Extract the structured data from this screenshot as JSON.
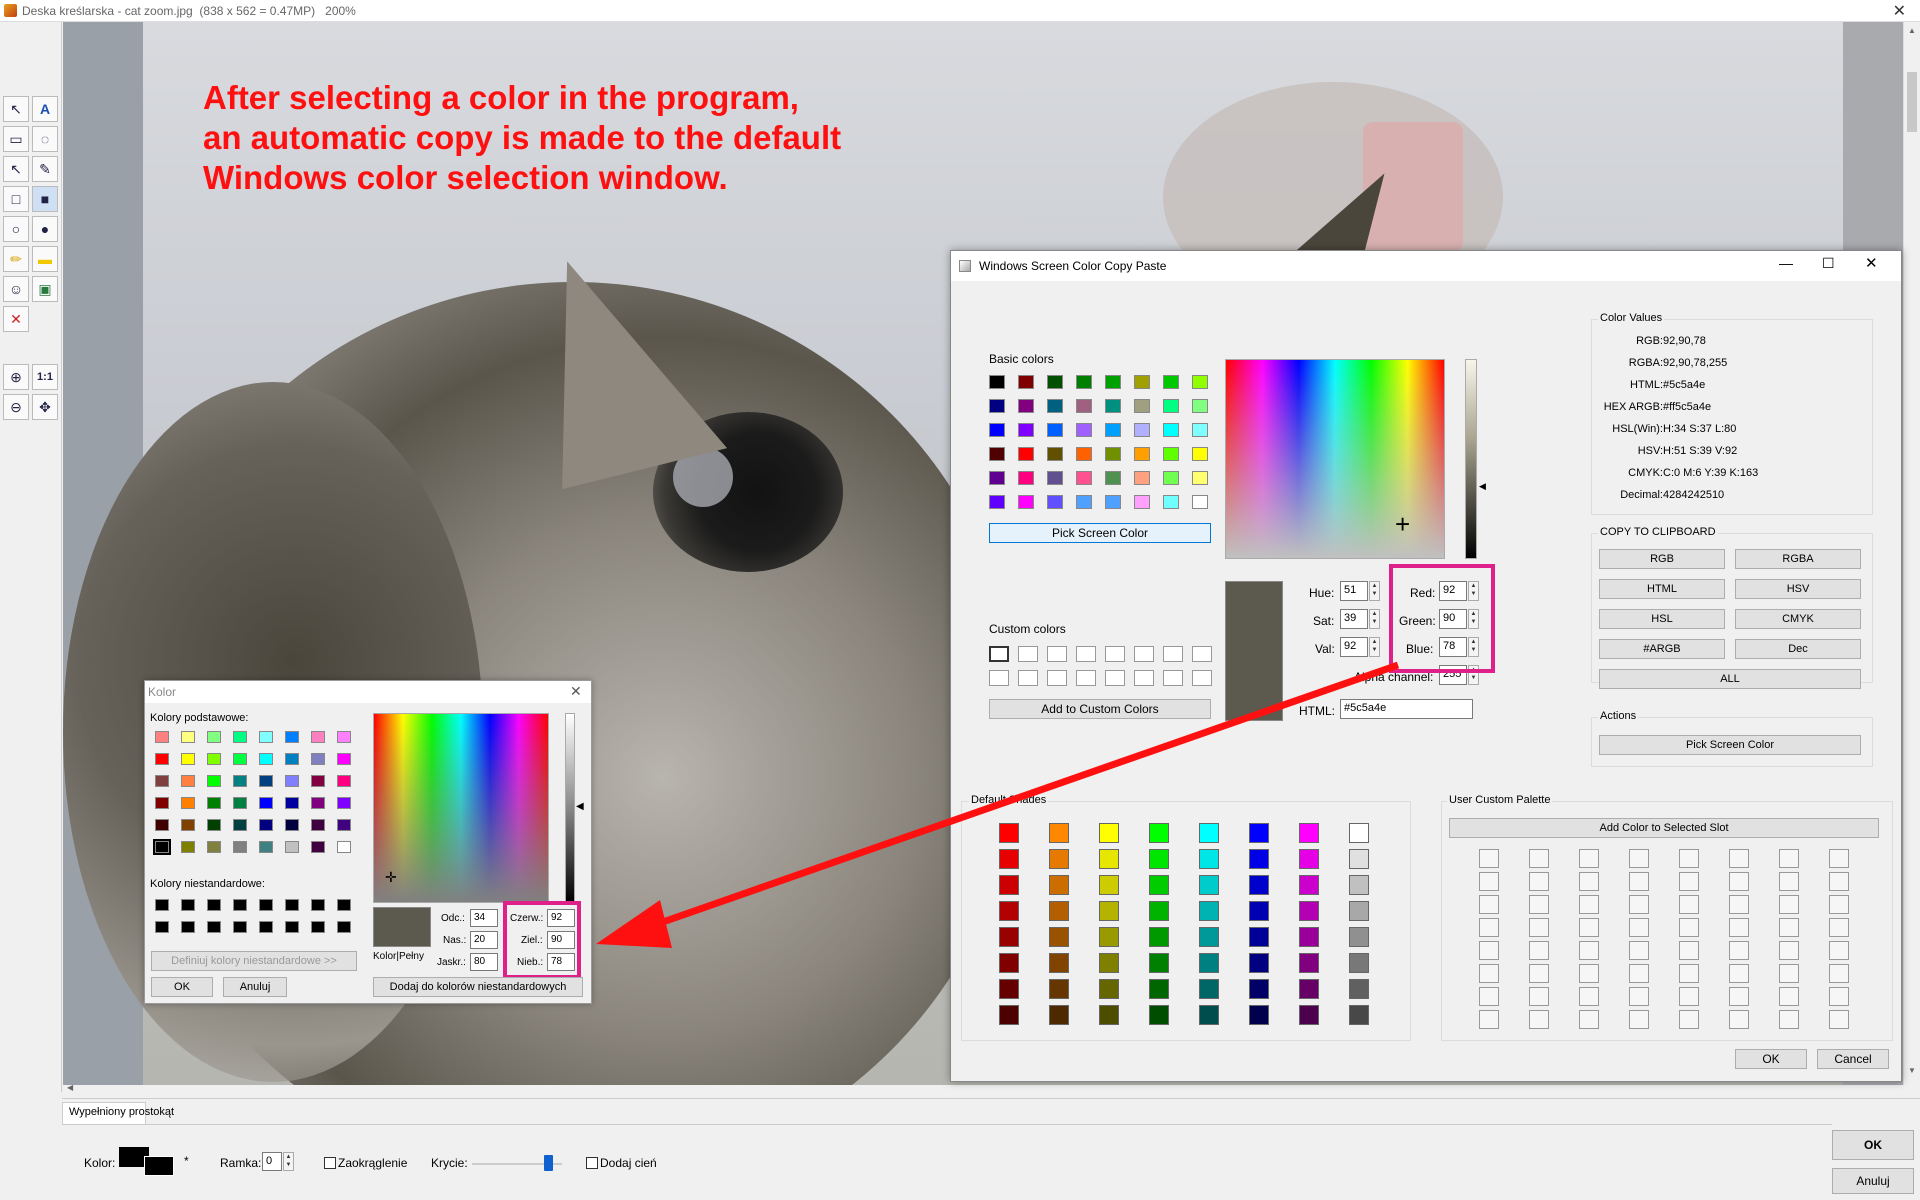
{
  "main_window": {
    "title": "Deska kreślarska  -  cat zoom.jpg",
    "image_info": "(838 x 562 = 0.47MP)",
    "zoom": "200%"
  },
  "annotation": {
    "line1": "After selecting a color in the program,",
    "line2": "an automatic copy is made to the default",
    "line3": "Windows color selection window.",
    "color": "#ff1010"
  },
  "toolbar": {
    "tools": [
      "select-arrow",
      "text",
      "callout",
      "lasso",
      "arrow",
      "pencil",
      "rectangle",
      "filled-rectangle",
      "ellipse",
      "filled-ellipse",
      "highlighter",
      "yellow-marker",
      "emoji",
      "image",
      "delete",
      "zoom-in",
      "actual-size",
      "zoom-out",
      "fit"
    ],
    "actual_size_label": "1:1"
  },
  "bottom_panel": {
    "tab": "Wypełniony prostokąt",
    "kolor_label": "Kolor:",
    "asterisk": "*",
    "ramka_label": "Ramka:",
    "ramka_value": "0",
    "zaokraglenie_label": "Zaokrąglenie",
    "krycie_label": "Krycie:",
    "krycie_value": 0.9,
    "dodaj_cien_label": "Dodaj cień",
    "ok_label": "OK",
    "anuluj_label": "Anuluj"
  },
  "wscp": {
    "title": "Windows Screen Color Copy Paste",
    "basic_colors_label": "Basic colors",
    "basic_colors": [
      "#000000",
      "#800000",
      "#005000",
      "#008000",
      "#00a000",
      "#a0a000",
      "#00c800",
      "#90ff00",
      "#000080",
      "#800080",
      "#006080",
      "#a06080",
      "#009080",
      "#a0a080",
      "#00ff80",
      "#80ff80",
      "#0000ff",
      "#8000ff",
      "#0060ff",
      "#a060ff",
      "#00a0ff",
      "#b0b0ff",
      "#00ffff",
      "#80ffff",
      "#500000",
      "#ff0000",
      "#605000",
      "#ff6000",
      "#709000",
      "#ffa000",
      "#60ff00",
      "#ffff00",
      "#600090",
      "#ff0080",
      "#605090",
      "#ff5090",
      "#509050",
      "#ffa080",
      "#70ff50",
      "#ffff70",
      "#6000ff",
      "#ff00ff",
      "#6050ff",
      "#50a0ff",
      "#50a0ff",
      "#ffa0ff",
      "#70ffff",
      "#ffffff"
    ],
    "pick_screen_color": "Pick Screen Color",
    "custom_colors_label": "Custom colors",
    "add_to_custom": "Add to Custom Colors",
    "current_color": "#5c5a4e",
    "hue_label": "Hue:",
    "hue": "51",
    "sat_label": "Sat:",
    "sat": "39",
    "val_label": "Val:",
    "val": "92",
    "red_label": "Red:",
    "red": "92",
    "green_label": "Green:",
    "green": "90",
    "blue_label": "Blue:",
    "blue": "78",
    "alpha_label": "Alpha channel:",
    "alpha": "255",
    "html_label": "HTML:",
    "html": "#5c5a4e",
    "color_values_label": "Color Values",
    "values": [
      {
        "k": "RGB:",
        "v": "92,90,78"
      },
      {
        "k": "RGBA:",
        "v": "92,90,78,255"
      },
      {
        "k": "HTML:",
        "v": "#5c5a4e"
      },
      {
        "k": "HEX ARGB:",
        "v": "#ff5c5a4e"
      },
      {
        "k": "HSL(Win):",
        "v": "H:34 S:37 L:80"
      },
      {
        "k": "HSV:",
        "v": "H:51 S:39 V:92"
      },
      {
        "k": "CMYK:",
        "v": "C:0 M:6 Y:39 K:163"
      },
      {
        "k": "Decimal:",
        "v": "4284242510"
      }
    ],
    "copy_label": "COPY TO CLIPBOARD",
    "copy_buttons": [
      "RGB",
      "RGBA",
      "HTML",
      "HSV",
      "HSL",
      "CMYK",
      "#ARGB",
      "Dec"
    ],
    "all_label": "ALL",
    "actions_label": "Actions",
    "pick_screen_color2": "Pick Screen Color",
    "default_shades_label": "Default Shades",
    "default_shades": [
      [
        "#ff0000",
        "#ff8800",
        "#ffff00",
        "#00ff00",
        "#00ffff",
        "#0000ff",
        "#ff00ff",
        "#ffffff"
      ],
      [
        "#e60000",
        "#e67a00",
        "#e6e600",
        "#00e600",
        "#00e6e6",
        "#0000e6",
        "#e600e6",
        "#e0e0e0"
      ],
      [
        "#cc0000",
        "#cc6d00",
        "#cccc00",
        "#00cc00",
        "#00cccc",
        "#0000cc",
        "#cc00cc",
        "#c0c0c0"
      ],
      [
        "#b30000",
        "#b35f00",
        "#b3b300",
        "#00b300",
        "#00b3b3",
        "#0000b3",
        "#b300b3",
        "#a8a8a8"
      ],
      [
        "#990000",
        "#995200",
        "#999900",
        "#009900",
        "#009999",
        "#000099",
        "#990099",
        "#909090"
      ],
      [
        "#800000",
        "#804400",
        "#808000",
        "#008000",
        "#008080",
        "#000080",
        "#800080",
        "#787878"
      ],
      [
        "#660000",
        "#663600",
        "#666600",
        "#006600",
        "#006666",
        "#000066",
        "#660066",
        "#606060"
      ],
      [
        "#4d0000",
        "#4d2900",
        "#4d4d00",
        "#004d00",
        "#004d4d",
        "#00004d",
        "#4d004d",
        "#484848"
      ]
    ],
    "user_palette_label": "User Custom Palette",
    "add_color_slot": "Add Color to Selected Slot",
    "ok": "OK",
    "cancel": "Cancel"
  },
  "kolor_dialog": {
    "title": "Kolor",
    "basic_label": "Kolory podstawowe:",
    "basic": [
      "#ff8080",
      "#ffff80",
      "#80ff80",
      "#00ff80",
      "#80ffff",
      "#0080ff",
      "#ff80c0",
      "#ff80ff",
      "#ff0000",
      "#ffff00",
      "#80ff00",
      "#00ff40",
      "#00ffff",
      "#0080c0",
      "#8080c0",
      "#ff00ff",
      "#804040",
      "#ff8040",
      "#00ff00",
      "#008080",
      "#004080",
      "#8080ff",
      "#800040",
      "#ff0080",
      "#800000",
      "#ff8000",
      "#008000",
      "#008040",
      "#0000ff",
      "#0000a0",
      "#800080",
      "#8000ff",
      "#400000",
      "#804000",
      "#004000",
      "#004040",
      "#000080",
      "#000040",
      "#400040",
      "#400080",
      "#000000",
      "#808000",
      "#808040",
      "#808080",
      "#408080",
      "#c0c0c0",
      "#400040",
      "#ffffff"
    ],
    "custom_label": "Kolory niestandardowe:",
    "define_custom": "Definiuj kolory niestandardowe >>",
    "ok": "OK",
    "anuluj": "Anuluj",
    "current_color": "#5c5a4e",
    "kolor_pelny": "Kolor|Pełny",
    "odc_label": "Odc.:",
    "odc": "34",
    "nas_label": "Nas.:",
    "nas": "20",
    "jaskr_label": "Jaskr.:",
    "jaskr": "80",
    "czerw_label": "Czerw.:",
    "czerw": "92",
    "ziel_label": "Ziel.:",
    "ziel": "90",
    "nieb_label": "Nieb.:",
    "nieb": "78",
    "add_custom": "Dodaj do kolorów niestandardowych"
  },
  "colors": {
    "highlight_box": "#e0208a",
    "arrow": "#ff1010"
  }
}
